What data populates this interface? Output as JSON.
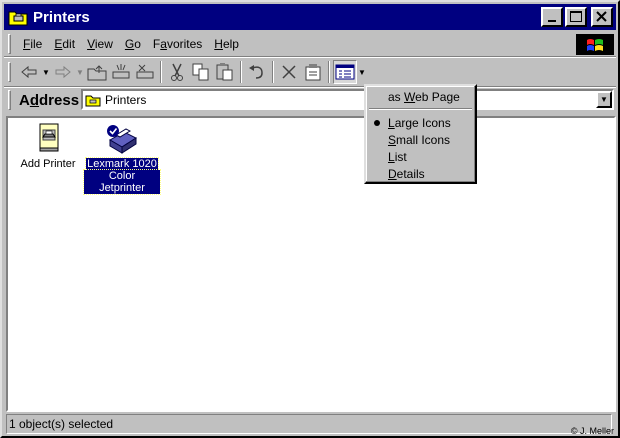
{
  "window": {
    "title": "Printers"
  },
  "menubar": {
    "items": [
      {
        "pre": "",
        "key": "F",
        "post": "ile"
      },
      {
        "pre": "",
        "key": "E",
        "post": "dit"
      },
      {
        "pre": "",
        "key": "V",
        "post": "iew"
      },
      {
        "pre": "",
        "key": "G",
        "post": "o"
      },
      {
        "pre": "F",
        "key": "a",
        "post": "vorites"
      },
      {
        "pre": "",
        "key": "H",
        "post": "elp"
      }
    ]
  },
  "address": {
    "label_pre": "A",
    "label_key": "d",
    "label_post": "dress",
    "value": "Printers"
  },
  "items": [
    {
      "label_line1": "Add Printer",
      "label_line2": ""
    },
    {
      "label_line1": "Lexmark 1020",
      "label_line2": "Color Jetprinter"
    }
  ],
  "status": {
    "text": "1 object(s) selected",
    "copyright": "© J. Meller"
  },
  "view_menu": {
    "web_pre": "as ",
    "web_key": "W",
    "web_post": "eb Page",
    "large_pre": "",
    "large_key": "L",
    "large_post": "arge Icons",
    "small_pre": "",
    "small_key": "S",
    "small_post": "mall Icons",
    "list_pre": "",
    "list_key": "L",
    "list_post": "ist",
    "details_pre": "",
    "details_key": "D",
    "details_post": "etails",
    "selected": "Large Icons"
  },
  "colors": {
    "titlebar": "#000080",
    "face": "#c0c0c0",
    "selection": "#000080"
  }
}
